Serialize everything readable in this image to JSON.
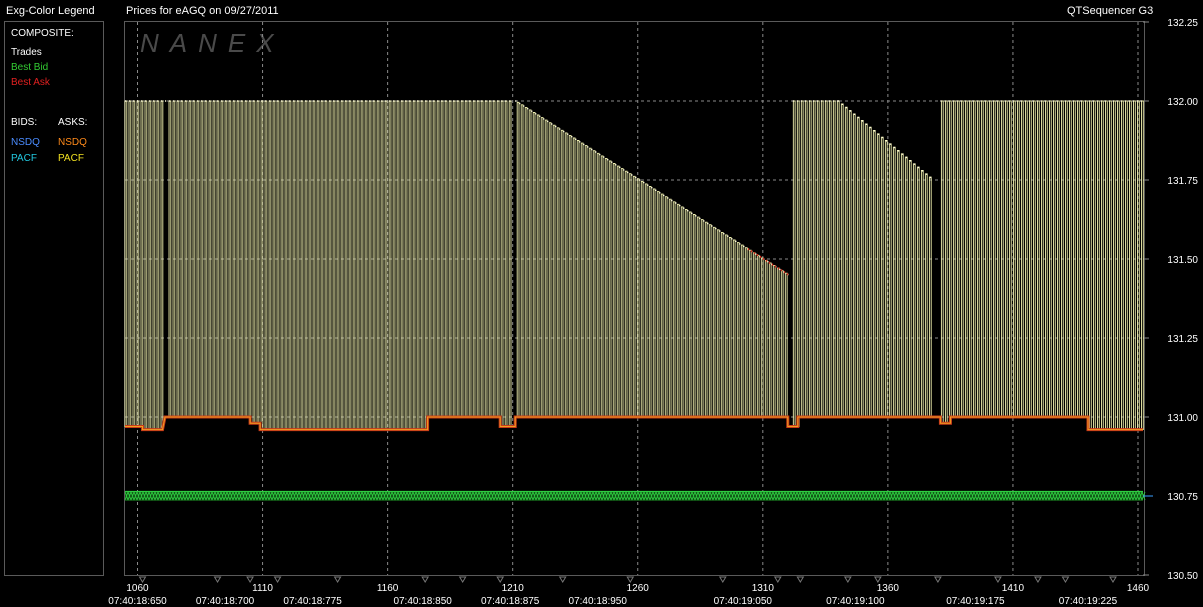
{
  "header": {
    "legend_title": "Exg-Color Legend",
    "chart_title": "Prices for  eAGQ  on  09/27/2011",
    "app_name": "QTSequencer G3"
  },
  "legend": {
    "composite_label": "COMPOSITE:",
    "trades": {
      "label": "Trades",
      "color": "#ffffff"
    },
    "best_bid": {
      "label": "Best Bid",
      "color": "#33cc33"
    },
    "best_ask": {
      "label": "Best Ask",
      "color": "#e02020"
    },
    "bids_label": "BIDS:",
    "asks_label": "ASKS:",
    "bids": [
      {
        "label": "NSDQ",
        "color": "#4a8cff"
      },
      {
        "label": "PACF",
        "color": "#22c8e0"
      }
    ],
    "asks": [
      {
        "label": "NSDQ",
        "color": "#ff8a1a"
      },
      {
        "label": "PACF",
        "color": "#f0e020"
      }
    ]
  },
  "watermark": "NANEX",
  "chart_data": {
    "type": "line",
    "ylim": [
      130.5,
      132.25
    ],
    "y_ticks": [
      "132.25",
      "132.00",
      "131.75",
      "131.50",
      "131.25",
      "131.00",
      "130.75",
      "130.50"
    ],
    "xlim": [
      1055,
      1462
    ],
    "x_ticks": [
      "1060",
      "1110",
      "1160",
      "1210",
      "1260",
      "1310",
      "1360",
      "1410",
      "1460"
    ],
    "time_labels": [
      {
        "x": 1060,
        "label": "07:40:18:650"
      },
      {
        "x": 1095,
        "label": "07:40:18:700"
      },
      {
        "x": 1130,
        "label": "07:40:18:775"
      },
      {
        "x": 1174,
        "label": "07:40:18:850"
      },
      {
        "x": 1209,
        "label": "07:40:18:875"
      },
      {
        "x": 1244,
        "label": "07:40:18:950"
      },
      {
        "x": 1302,
        "label": "07:40:19:050"
      },
      {
        "x": 1347,
        "label": "07:40:19:100"
      },
      {
        "x": 1395,
        "label": "07:40:19:175"
      },
      {
        "x": 1440,
        "label": "07:40:19:225"
      }
    ],
    "best_bid_level": 130.75,
    "ask_segments": [
      {
        "from": 1055,
        "to": 1070,
        "start": 132.0,
        "end": 132.0
      },
      {
        "from": 1071,
        "to": 1209,
        "start": 132.0,
        "end": 132.0
      },
      {
        "from": 1211,
        "to": 1320,
        "start": 132.0,
        "end": 131.45
      },
      {
        "from": 1322,
        "to": 1340,
        "start": 132.0,
        "end": 132.0
      },
      {
        "from": 1340,
        "to": 1378,
        "start": 132.0,
        "end": 131.75
      },
      {
        "from": 1381,
        "to": 1462,
        "start": 132.0,
        "end": 132.0
      }
    ],
    "base_segments": [
      {
        "from": 1055,
        "to": 1062,
        "value": 130.97
      },
      {
        "from": 1062,
        "to": 1070,
        "value": 130.96
      },
      {
        "from": 1071,
        "to": 1105,
        "value": 131.0
      },
      {
        "from": 1105,
        "to": 1109,
        "value": 130.98
      },
      {
        "from": 1109,
        "to": 1176,
        "value": 130.96
      },
      {
        "from": 1176,
        "to": 1205,
        "value": 131.0
      },
      {
        "from": 1205,
        "to": 1211,
        "value": 130.97
      },
      {
        "from": 1211,
        "to": 1320,
        "value": 131.0
      },
      {
        "from": 1320,
        "to": 1324,
        "value": 130.97
      },
      {
        "from": 1324,
        "to": 1381,
        "value": 131.0
      },
      {
        "from": 1381,
        "to": 1385,
        "value": 130.98
      },
      {
        "from": 1385,
        "to": 1440,
        "value": 131.0
      },
      {
        "from": 1440,
        "to": 1462,
        "value": 130.96
      }
    ],
    "trade_bars": {
      "step": 1.6
    }
  },
  "colors": {
    "grid": "#8a8a8a",
    "trade_line": "#f2f2b0",
    "ask_base": "#c83a1a",
    "bid_band": "#2ecc40",
    "cursor": "#3aa0ff"
  }
}
